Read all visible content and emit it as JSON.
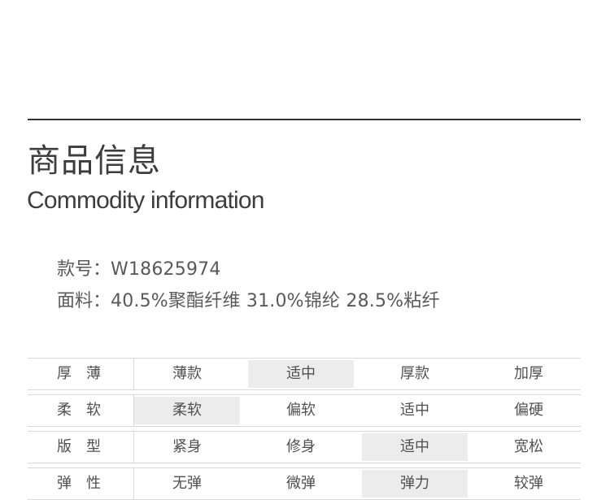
{
  "section": {
    "title_zh": "商品信息",
    "title_en": "Commodity information"
  },
  "info": {
    "style_no_label": "款号：",
    "style_no": "W18625974",
    "fabric_label": "面料：",
    "fabric": "40.5%聚酯纤维 31.0%锦纶 28.5%粘纤"
  },
  "spec_table": {
    "rows": [
      {
        "label": "厚薄",
        "options": [
          "薄款",
          "适中",
          "厚款",
          "加厚"
        ],
        "selected_index": 1
      },
      {
        "label": "柔软",
        "options": [
          "柔软",
          "偏软",
          "适中",
          "偏硬"
        ],
        "selected_index": 0
      },
      {
        "label": "版型",
        "options": [
          "紧身",
          "修身",
          "适中",
          "宽松"
        ],
        "selected_index": 2
      },
      {
        "label": "弹性",
        "options": [
          "无弹",
          "微弹",
          "弹力",
          "较弹"
        ],
        "selected_index": 2
      }
    ]
  },
  "colors": {
    "text": "#4a4a4a",
    "rule": "#333333",
    "table_border": "#d9d9d9",
    "selected_bg": "#ececec"
  }
}
